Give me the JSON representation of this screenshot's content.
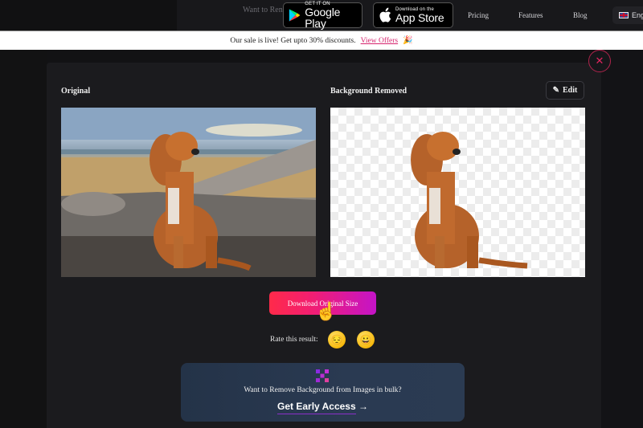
{
  "topbar": {
    "teaser_text": "Want to Ren",
    "google_play": {
      "small": "GET IT ON",
      "big": "Google Play"
    },
    "app_store": {
      "small": "Download on the",
      "big": "App Store"
    },
    "nav": [
      "Pricing",
      "Features",
      "Blog"
    ],
    "language": "Eng"
  },
  "banner": {
    "text": "Our sale is live! Get upto 30% discounts.",
    "link": "View Offers",
    "emoji": "🎉"
  },
  "result": {
    "close_symbol": "✕",
    "original_label": "Original",
    "removed_label": "Background Removed",
    "edit_label": "Edit",
    "edit_icon": "✎",
    "download_label": "Download Original Size",
    "rate_label": "Rate this result:",
    "rating_emojis": [
      "😔",
      "😀"
    ]
  },
  "bulk": {
    "text": "Want to Remove Background from Images in bulk?",
    "cta": "Get Early Access",
    "arrow": "→"
  },
  "colors": {
    "accent_pink": "#e0245e",
    "gradient_start": "#ff2a4a",
    "gradient_end": "#c414c8",
    "bulk_bg": "#263650"
  }
}
